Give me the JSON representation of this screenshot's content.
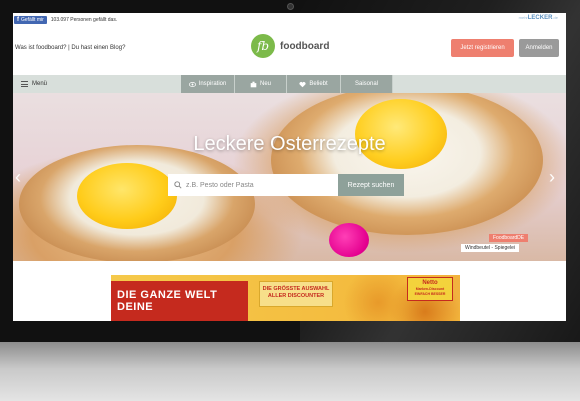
{
  "fb": {
    "like_label": "Gefällt mir",
    "count_text": "103.097 Personen gefällt das."
  },
  "partner": {
    "name": "LECKER",
    "prefix": "mehr",
    "suffix": ".de"
  },
  "header": {
    "links": "Was ist foodboard?  |  Du hast einen Blog?",
    "logo_mark": "fb",
    "logo_text": "foodboard",
    "register_label": "Jetzt registrieren",
    "login_label": "Anmelden"
  },
  "nav": {
    "menu_label": "Menü",
    "tabs": [
      {
        "label": "Inspiration",
        "icon": "eye-icon"
      },
      {
        "label": "Neu",
        "icon": "box-icon"
      },
      {
        "label": "Beliebt",
        "icon": "heart-icon"
      },
      {
        "label": "Saisonal",
        "icon": ""
      }
    ]
  },
  "hero": {
    "title": "Leckere Osterrezepte",
    "search_placeholder": "z.B. Pesto oder Pasta",
    "search_button": "Rezept suchen",
    "prev_arrow": "‹",
    "next_arrow": "›",
    "credit_source": "FoodboardDE",
    "credit_caption": "Windbeutel - Spiegelei"
  },
  "ad": {
    "headline": "DIE GANZE WELT",
    "headline2": "DEINE",
    "middle_text": "DIE GRÖSSTE AUSWAHL ALLER DISCOUNTER",
    "brand": "Netto",
    "brand_sub": "Marken-Discount",
    "brand_tag": "EINFACH BESSER"
  }
}
